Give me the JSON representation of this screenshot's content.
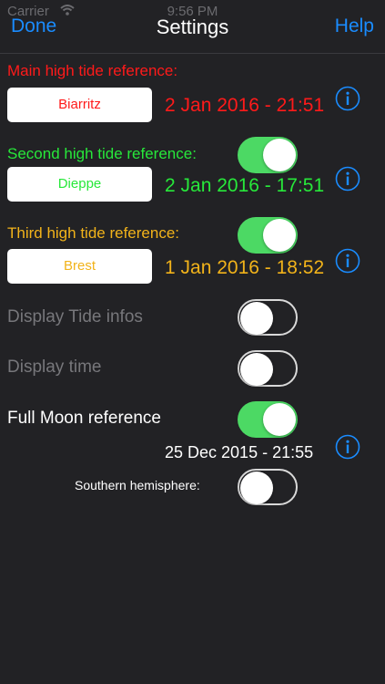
{
  "status_bar": {
    "carrier": "Carrier",
    "time": "9:56 PM"
  },
  "nav": {
    "done_label": "Done",
    "title": "Settings",
    "help_label": "Help"
  },
  "colors": {
    "accent": "#1a8cff",
    "red": "#ff1a1a",
    "green": "#27e83a",
    "yellow": "#f2b31a",
    "toggle_on": "#4cd964",
    "disabled_text": "#77777b"
  },
  "main_reference": {
    "label": "Main high tide reference:",
    "station": "Biarritz",
    "datetime": "2 Jan 2016 - 21:51"
  },
  "second_reference": {
    "label": "Second high tide reference:",
    "station": "Dieppe",
    "datetime": "2 Jan 2016 - 17:51",
    "enabled": true
  },
  "third_reference": {
    "label": "Third high tide reference:",
    "station": "Brest",
    "datetime": "1 Jan 2016 - 18:52",
    "enabled": true
  },
  "display_tide_infos": {
    "label": "Display Tide infos",
    "enabled": false
  },
  "display_time": {
    "label": "Display time",
    "enabled": false
  },
  "full_moon": {
    "label": "Full Moon reference",
    "enabled": true,
    "datetime": "25 Dec 2015 - 21:55"
  },
  "southern_hemisphere": {
    "label": "Southern hemisphere:",
    "enabled": false
  },
  "icons": {
    "info": "info-circle-icon",
    "wifi": "wifi-icon"
  }
}
